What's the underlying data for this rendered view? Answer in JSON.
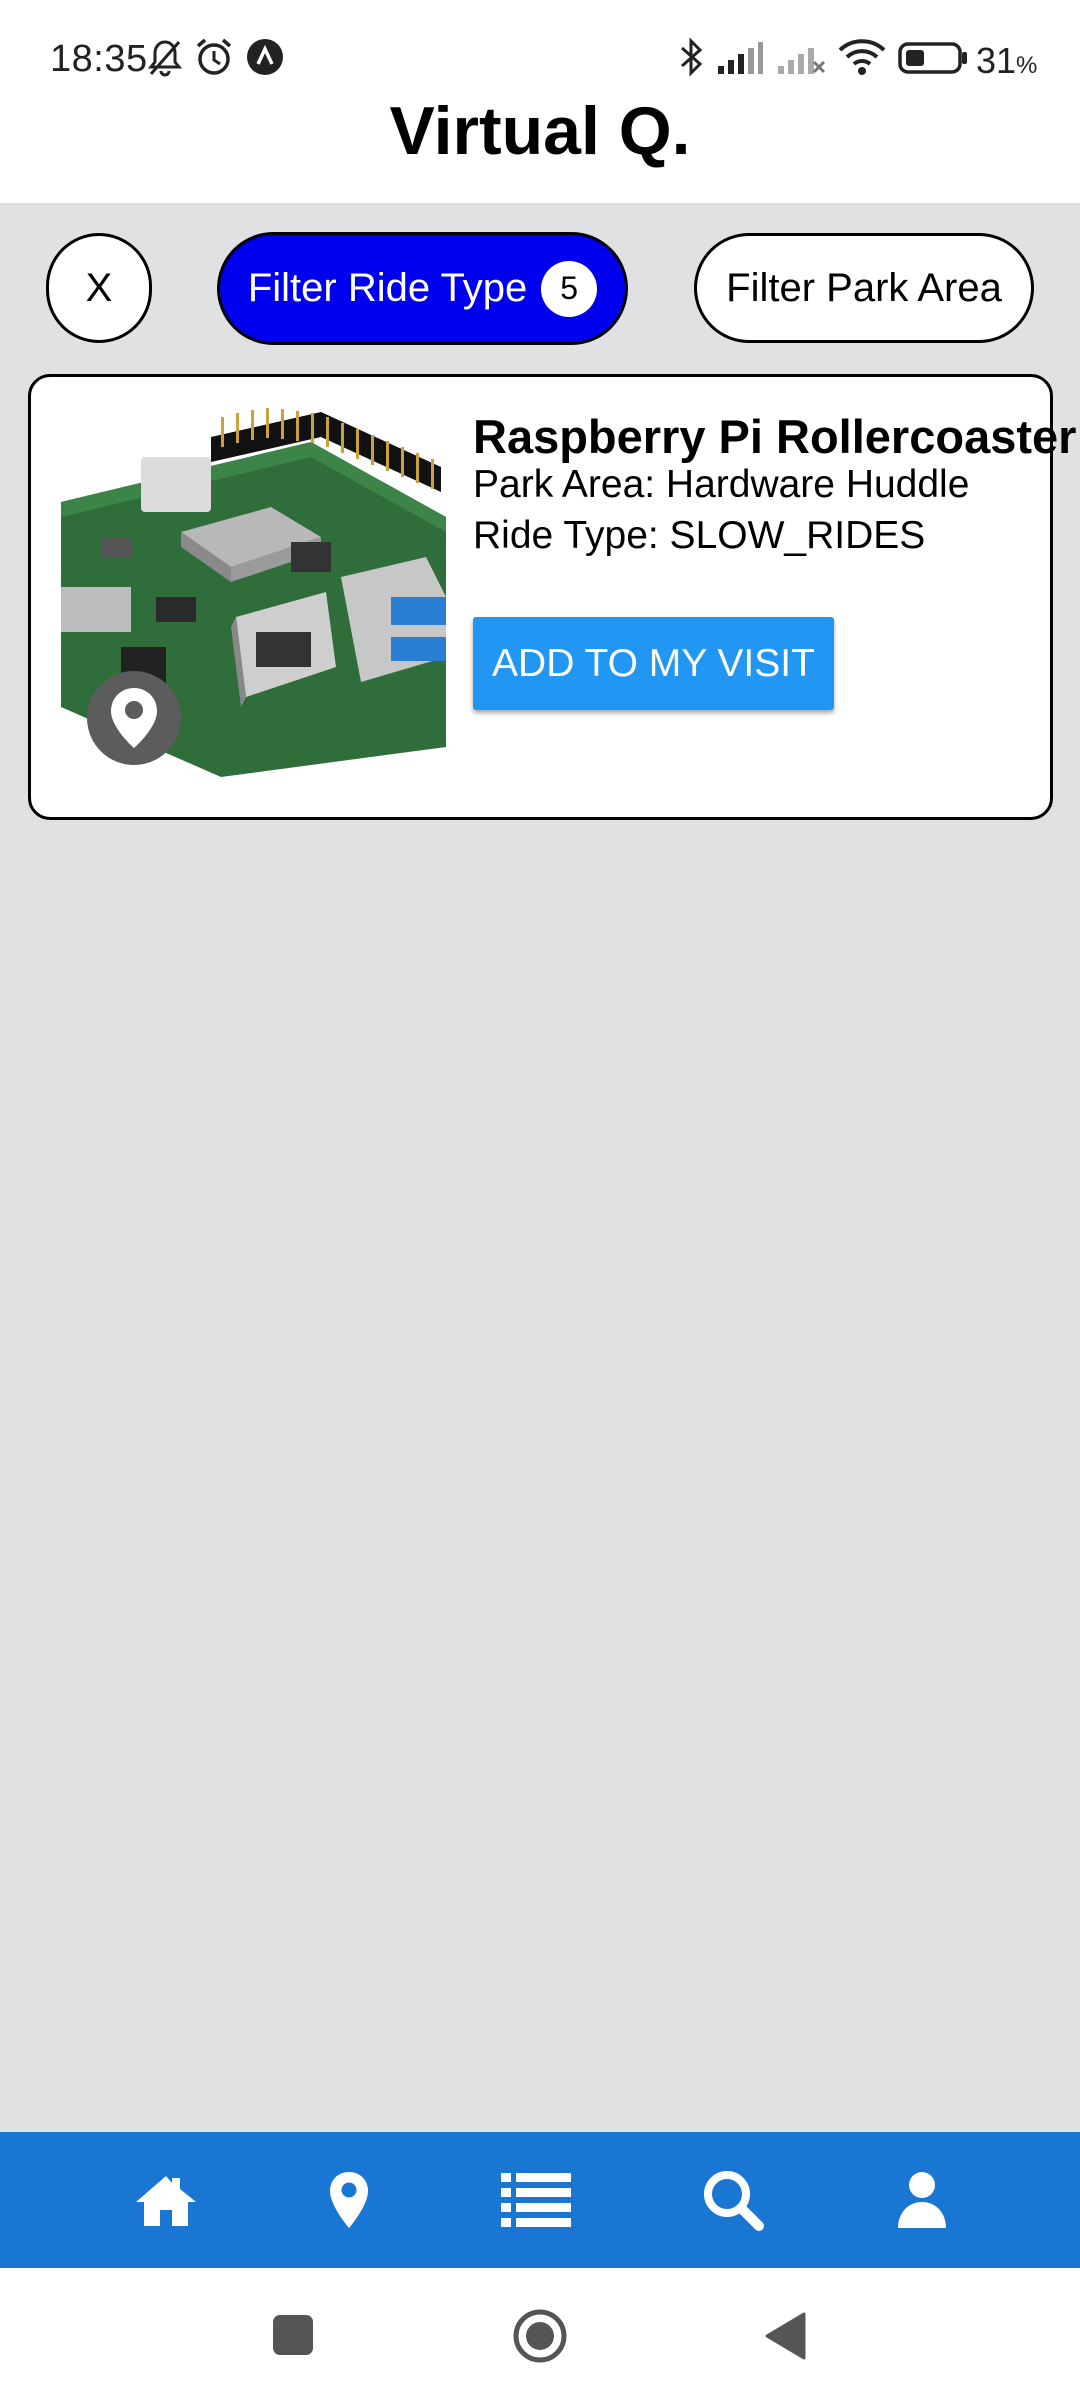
{
  "status_bar": {
    "time": "18:35",
    "battery_percent": "31",
    "battery_unit": "%",
    "icons": [
      "bell-off-icon",
      "alarm-icon",
      "app-notification-icon",
      "bluetooth-icon",
      "signal-icon",
      "signal-no-service-icon",
      "wifi-icon",
      "battery-icon"
    ]
  },
  "header": {
    "title": "Virtual Q."
  },
  "filters": {
    "clear_label": "X",
    "ride_type_label": "Filter Ride Type",
    "ride_type_count": "5",
    "park_area_label": "Filter Park Area"
  },
  "rides": [
    {
      "name": "Raspberry Pi Rollercoaster",
      "park_area": "Park Area: Hardware Huddle",
      "ride_type": "Ride Type: SLOW_RIDES",
      "button_label": "ADD TO MY VISIT",
      "image": "raspberry-pi-board",
      "badge_icon": "map-pin-icon"
    }
  ],
  "bottom_nav": {
    "items": [
      "home-icon",
      "map-pin-icon",
      "list-icon",
      "search-icon",
      "user-icon"
    ]
  },
  "system_nav": [
    "recents-button",
    "home-button",
    "back-button"
  ],
  "colors": {
    "background": "#e0e1e3",
    "chip_active": "#0000ee",
    "primary_button": "#2196f3",
    "bottom_nav": "#1976d2"
  }
}
